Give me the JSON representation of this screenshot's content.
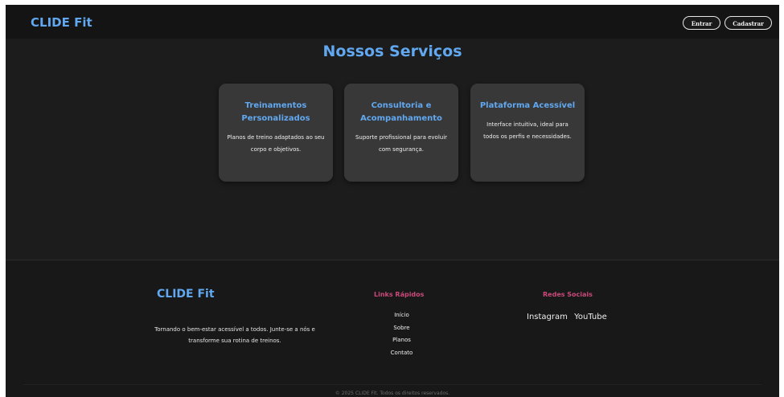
{
  "header": {
    "brand": "CLIDE Fit",
    "login_label": "Entrar",
    "signup_label": "Cadastrar"
  },
  "services": {
    "title": "Nossos Serviços",
    "cards": [
      {
        "title": "Treinamentos Personalizados",
        "text": "Planos de treino adaptados ao seu corpo e objetivos."
      },
      {
        "title": "Consultoria e Acompanhamento",
        "text": "Suporte profissional para evoluir com segurança."
      },
      {
        "title": "Plataforma Acessível",
        "text": "Interface intuitiva, ideal para todos os perfis e necessidades."
      }
    ]
  },
  "footer": {
    "brand": "CLIDE Fit",
    "tagline": "Tornando o bem-estar acessível a todos. Junte-se a nós e transforme sua rotina de treinos.",
    "links_title": "Links Rápidos",
    "links": [
      "Início",
      "Sobre",
      "Planos",
      "Contato"
    ],
    "social_title": "Redes Sociais",
    "social": [
      "Instagram",
      "YouTube"
    ],
    "copyright": "© 2025 CLIDE Fit. Todos os direitos reservados."
  },
  "colors": {
    "accent": "#61a8f0",
    "footer_heading": "#c94a7a",
    "background": "#1c1c1c",
    "card": "#383838"
  }
}
